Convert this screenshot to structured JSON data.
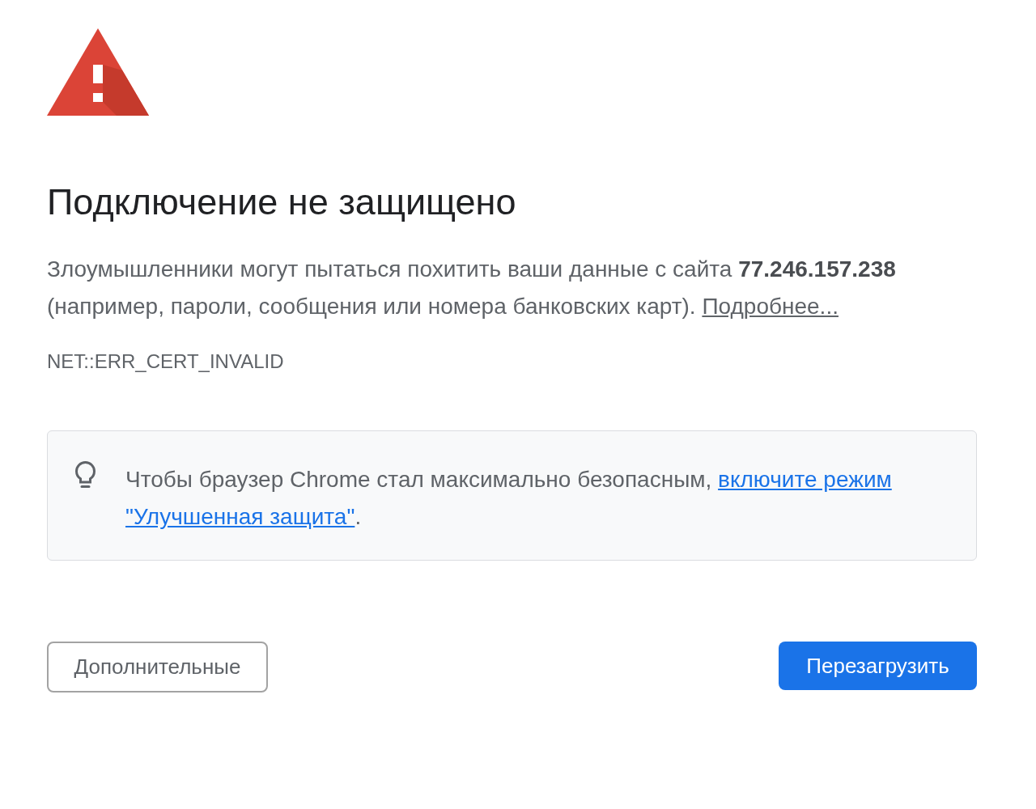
{
  "warning": {
    "title": "Подключение не защищено",
    "message": "Злоумышленники могут пытаться похитить ваши данные с сайта **77.246.157.238** (например, пароли, сообщения или номера банковских карт).",
    "details_link": "Подробнее...",
    "error_code": "NET::ERR_CERT_INVALID"
  },
  "tip": {
    "text": "Чтобы браузер Chrome стал максимально безопасным,",
    "link_lines": [
      "включите режим",
      "\"Улучшенная защита\""
    ],
    "end": "."
  },
  "buttons": [
    {
      "label": "Дополнительные",
      "kind": "secondary"
    },
    {
      "label": "Перезагрузить",
      "kind": "primary"
    }
  ]
}
